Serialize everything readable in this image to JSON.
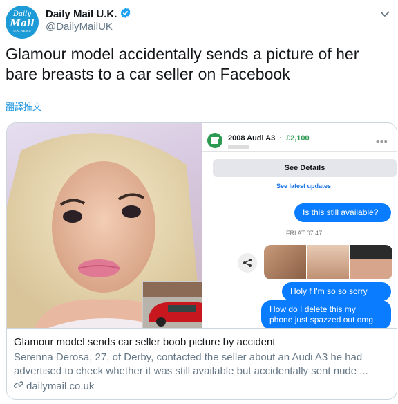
{
  "account": {
    "avatar_line1": "Daily",
    "avatar_line2": "Mail",
    "avatar_line3": "U.K. NEWS",
    "name": "Daily Mail U.K.",
    "handle": "@DailyMailUK"
  },
  "tweet": {
    "text": "Glamour model accidentally sends a picture of her bare breasts to a car seller on Facebook",
    "translate_label": "翻譯推文"
  },
  "card": {
    "title": "Glamour model sends car seller boob picture by accident",
    "description_line1": "Serenna Derosa, 27, of Derby, contacted the seller about an Audi A3 he had",
    "description_line2": "advertised to check whether it was still available but accidentally sent nude ...",
    "domain": "dailymail.co.uk"
  },
  "chat": {
    "listing_title": "2008 Audi A3",
    "listing_sep": "·",
    "listing_price": "£2,100",
    "see_details": "See Details",
    "see_latest": "See latest updates",
    "msg_available": "Is this still available?",
    "timestamp": "FRI AT 07:47",
    "msg_sorry": "Holy f    I'm so so sorry",
    "msg_delete_line1": "How do I delete this my",
    "msg_delete_line2": "phone just spazzed out omg"
  },
  "colors": {
    "brand_blue": "#1d9bd6",
    "link_blue": "#1b95e0",
    "messenger_blue": "#0a7cff",
    "price_green": "#2d9a52"
  },
  "icons": {
    "verified": "verified-badge-icon",
    "more": "chevron-down-icon",
    "link": "link-icon",
    "share": "share-icon",
    "car": "car-icon"
  }
}
